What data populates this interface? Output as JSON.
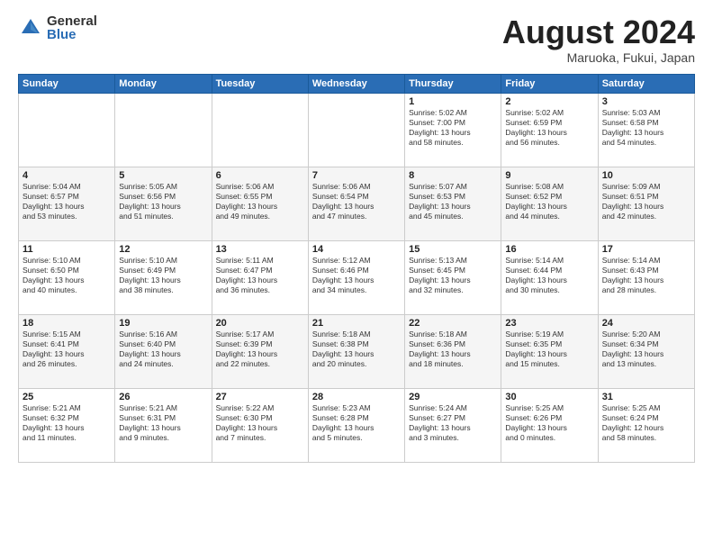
{
  "logo": {
    "general": "General",
    "blue": "Blue"
  },
  "header": {
    "month": "August 2024",
    "location": "Maruoka, Fukui, Japan"
  },
  "weekdays": [
    "Sunday",
    "Monday",
    "Tuesday",
    "Wednesday",
    "Thursday",
    "Friday",
    "Saturday"
  ],
  "weeks": [
    [
      {
        "day": "",
        "info": ""
      },
      {
        "day": "",
        "info": ""
      },
      {
        "day": "",
        "info": ""
      },
      {
        "day": "",
        "info": ""
      },
      {
        "day": "1",
        "info": "Sunrise: 5:02 AM\nSunset: 7:00 PM\nDaylight: 13 hours\nand 58 minutes."
      },
      {
        "day": "2",
        "info": "Sunrise: 5:02 AM\nSunset: 6:59 PM\nDaylight: 13 hours\nand 56 minutes."
      },
      {
        "day": "3",
        "info": "Sunrise: 5:03 AM\nSunset: 6:58 PM\nDaylight: 13 hours\nand 54 minutes."
      }
    ],
    [
      {
        "day": "4",
        "info": "Sunrise: 5:04 AM\nSunset: 6:57 PM\nDaylight: 13 hours\nand 53 minutes."
      },
      {
        "day": "5",
        "info": "Sunrise: 5:05 AM\nSunset: 6:56 PM\nDaylight: 13 hours\nand 51 minutes."
      },
      {
        "day": "6",
        "info": "Sunrise: 5:06 AM\nSunset: 6:55 PM\nDaylight: 13 hours\nand 49 minutes."
      },
      {
        "day": "7",
        "info": "Sunrise: 5:06 AM\nSunset: 6:54 PM\nDaylight: 13 hours\nand 47 minutes."
      },
      {
        "day": "8",
        "info": "Sunrise: 5:07 AM\nSunset: 6:53 PM\nDaylight: 13 hours\nand 45 minutes."
      },
      {
        "day": "9",
        "info": "Sunrise: 5:08 AM\nSunset: 6:52 PM\nDaylight: 13 hours\nand 44 minutes."
      },
      {
        "day": "10",
        "info": "Sunrise: 5:09 AM\nSunset: 6:51 PM\nDaylight: 13 hours\nand 42 minutes."
      }
    ],
    [
      {
        "day": "11",
        "info": "Sunrise: 5:10 AM\nSunset: 6:50 PM\nDaylight: 13 hours\nand 40 minutes."
      },
      {
        "day": "12",
        "info": "Sunrise: 5:10 AM\nSunset: 6:49 PM\nDaylight: 13 hours\nand 38 minutes."
      },
      {
        "day": "13",
        "info": "Sunrise: 5:11 AM\nSunset: 6:47 PM\nDaylight: 13 hours\nand 36 minutes."
      },
      {
        "day": "14",
        "info": "Sunrise: 5:12 AM\nSunset: 6:46 PM\nDaylight: 13 hours\nand 34 minutes."
      },
      {
        "day": "15",
        "info": "Sunrise: 5:13 AM\nSunset: 6:45 PM\nDaylight: 13 hours\nand 32 minutes."
      },
      {
        "day": "16",
        "info": "Sunrise: 5:14 AM\nSunset: 6:44 PM\nDaylight: 13 hours\nand 30 minutes."
      },
      {
        "day": "17",
        "info": "Sunrise: 5:14 AM\nSunset: 6:43 PM\nDaylight: 13 hours\nand 28 minutes."
      }
    ],
    [
      {
        "day": "18",
        "info": "Sunrise: 5:15 AM\nSunset: 6:41 PM\nDaylight: 13 hours\nand 26 minutes."
      },
      {
        "day": "19",
        "info": "Sunrise: 5:16 AM\nSunset: 6:40 PM\nDaylight: 13 hours\nand 24 minutes."
      },
      {
        "day": "20",
        "info": "Sunrise: 5:17 AM\nSunset: 6:39 PM\nDaylight: 13 hours\nand 22 minutes."
      },
      {
        "day": "21",
        "info": "Sunrise: 5:18 AM\nSunset: 6:38 PM\nDaylight: 13 hours\nand 20 minutes."
      },
      {
        "day": "22",
        "info": "Sunrise: 5:18 AM\nSunset: 6:36 PM\nDaylight: 13 hours\nand 18 minutes."
      },
      {
        "day": "23",
        "info": "Sunrise: 5:19 AM\nSunset: 6:35 PM\nDaylight: 13 hours\nand 15 minutes."
      },
      {
        "day": "24",
        "info": "Sunrise: 5:20 AM\nSunset: 6:34 PM\nDaylight: 13 hours\nand 13 minutes."
      }
    ],
    [
      {
        "day": "25",
        "info": "Sunrise: 5:21 AM\nSunset: 6:32 PM\nDaylight: 13 hours\nand 11 minutes."
      },
      {
        "day": "26",
        "info": "Sunrise: 5:21 AM\nSunset: 6:31 PM\nDaylight: 13 hours\nand 9 minutes."
      },
      {
        "day": "27",
        "info": "Sunrise: 5:22 AM\nSunset: 6:30 PM\nDaylight: 13 hours\nand 7 minutes."
      },
      {
        "day": "28",
        "info": "Sunrise: 5:23 AM\nSunset: 6:28 PM\nDaylight: 13 hours\nand 5 minutes."
      },
      {
        "day": "29",
        "info": "Sunrise: 5:24 AM\nSunset: 6:27 PM\nDaylight: 13 hours\nand 3 minutes."
      },
      {
        "day": "30",
        "info": "Sunrise: 5:25 AM\nSunset: 6:26 PM\nDaylight: 13 hours\nand 0 minutes."
      },
      {
        "day": "31",
        "info": "Sunrise: 5:25 AM\nSunset: 6:24 PM\nDaylight: 12 hours\nand 58 minutes."
      }
    ]
  ]
}
